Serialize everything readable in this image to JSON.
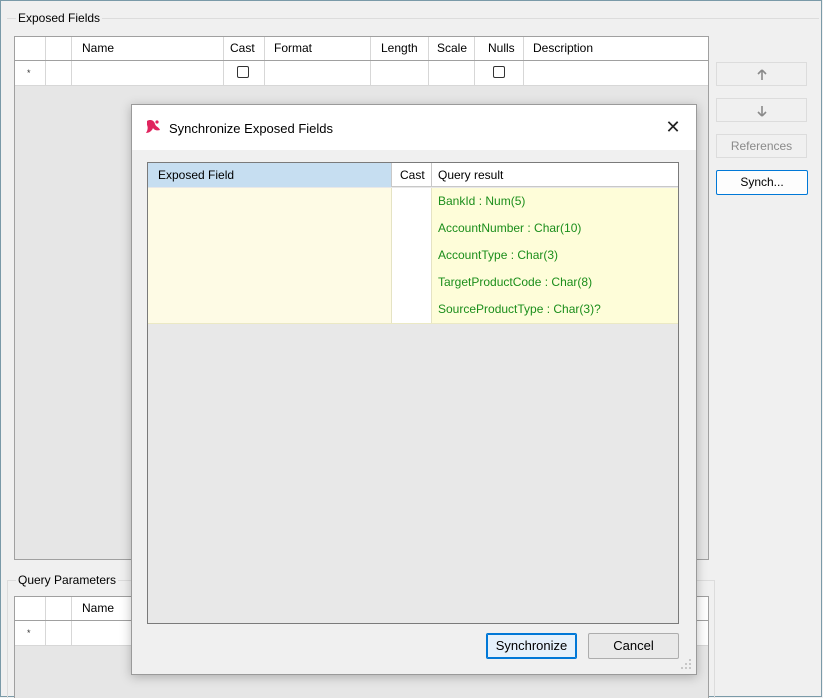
{
  "exposed_fields": {
    "title": "Exposed Fields",
    "columns": [
      "Name",
      "Cast",
      "Format",
      "Length",
      "Scale",
      "Nulls",
      "Description"
    ],
    "new_row_marker": "*"
  },
  "side_buttons": {
    "move_up_icon": "arrow-up-icon",
    "move_down_icon": "arrow-down-icon",
    "references": "References",
    "synch": "Synch..."
  },
  "query_parameters": {
    "title": "Query Parameters",
    "columns": [
      "Name"
    ],
    "new_row_marker": "*"
  },
  "dialog": {
    "title": "Synchronize Exposed Fields",
    "close": "✕",
    "columns": {
      "exposed_field": "Exposed Field",
      "cast": "Cast",
      "query_result": "Query result"
    },
    "rows": [
      {
        "exposed_field": "",
        "query_result": "BankId : Num(5)"
      },
      {
        "exposed_field": "",
        "query_result": "AccountNumber : Char(10)"
      },
      {
        "exposed_field": "",
        "query_result": "AccountType : Char(3)"
      },
      {
        "exposed_field": "",
        "query_result": "TargetProductCode : Char(8)"
      },
      {
        "exposed_field": "",
        "query_result": "SourceProductType : Char(3)?"
      }
    ],
    "synchronize": "Synchronize",
    "cancel": "Cancel"
  },
  "colors": {
    "accent": "#0078d7",
    "result_text": "#1b8e1b",
    "row_highlight": "#fefdd9",
    "header_selected": "#c6def1",
    "logo": "#e0245e"
  }
}
